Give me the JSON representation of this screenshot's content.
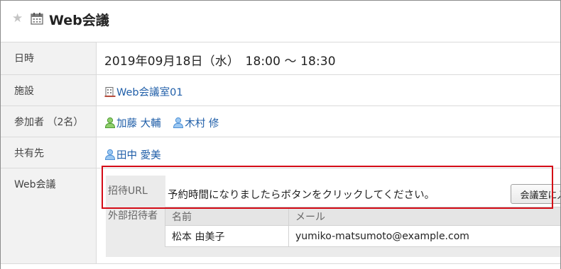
{
  "header": {
    "title": "Web会議",
    "star_icon": "star-icon",
    "calendar_icon": "calendar-icon"
  },
  "rows": {
    "datetime": {
      "label": "日時",
      "value": "2019年09月18日（水）　18:00 ～ 18:30"
    },
    "facility": {
      "label": "施設",
      "value": "Web会議室01",
      "icon": "facility-icon"
    },
    "participants": {
      "label": "参加者 （2名）",
      "users": [
        "加藤 大輔",
        "木村 修"
      ]
    },
    "share": {
      "label": "共有先",
      "users": [
        "田中 愛美"
      ]
    },
    "web": {
      "label": "Web会議",
      "invite_label": "招待URL",
      "message": "予約時間になりましたらボタンをクリックしてください。",
      "join_button": "会議室に入室する",
      "external_label": "外部招待者",
      "columns": [
        "名前",
        "メール"
      ],
      "guests": [
        {
          "name": "松本 由美子",
          "email": "yumiko-matsumoto@example.com"
        }
      ]
    }
  },
  "colors": {
    "link": "#1f5ea8",
    "user_icon_green": "#5aa53b",
    "user_icon_blue": "#4c8fd6",
    "highlight": "#d40b16",
    "label_bg": "#f2f2f2"
  }
}
